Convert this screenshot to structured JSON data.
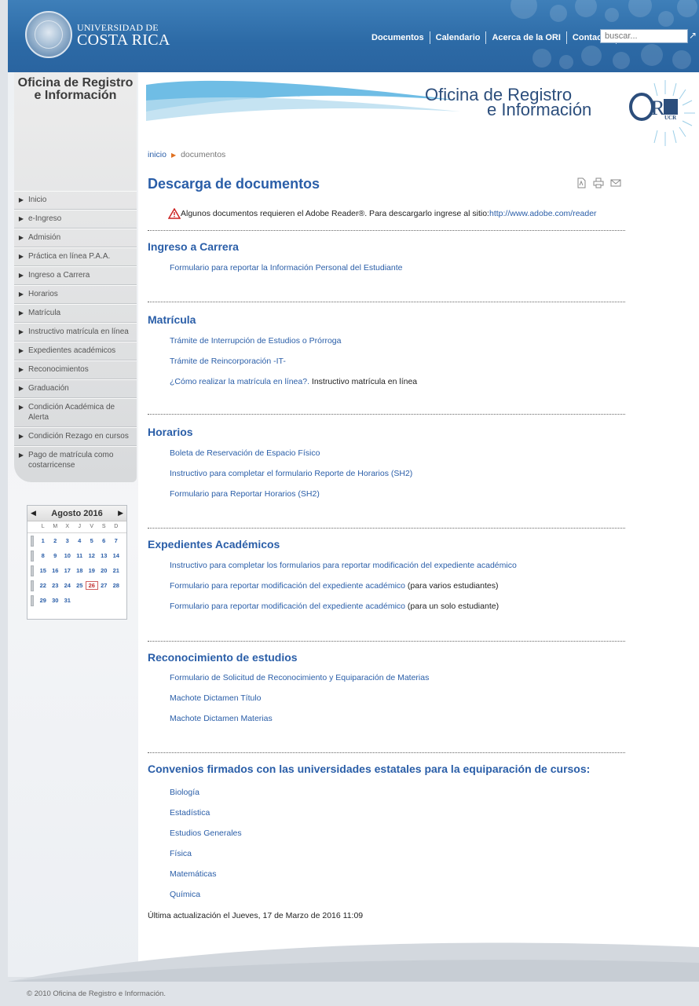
{
  "header": {
    "logo_line1": "UNIVERSIDAD DE",
    "logo_line2": "COSTA RICA",
    "nav": [
      "Documentos",
      "Calendario",
      "Acerca de la ORI",
      "Contacto"
    ],
    "search_placeholder": "buscar..."
  },
  "sidebar": {
    "title": "Oficina de Registro e Información",
    "items": [
      "Inicio",
      "e-Ingreso",
      "Admisión",
      "Práctica en línea P.A.A.",
      "Ingreso a Carrera",
      "Horarios",
      "Matrícula",
      "Instructivo matrícula en línea",
      "Expedientes académicos",
      "Reconocimientos",
      "Graduación",
      "Condición Académica de Alerta",
      "Condición Rezago en cursos",
      "Pago de matrícula como costarricense"
    ]
  },
  "calendar": {
    "month": "Agosto 2016",
    "days": [
      "L",
      "M",
      "X",
      "J",
      "V",
      "S",
      "D"
    ],
    "weeks": [
      [
        "1",
        "2",
        "3",
        "4",
        "5",
        "6",
        "7"
      ],
      [
        "8",
        "9",
        "10",
        "11",
        "12",
        "13",
        "14"
      ],
      [
        "15",
        "16",
        "17",
        "18",
        "19",
        "20",
        "21"
      ],
      [
        "22",
        "23",
        "24",
        "25",
        "26",
        "27",
        "28"
      ],
      [
        "29",
        "30",
        "31"
      ]
    ],
    "today": "26"
  },
  "banner": {
    "title_line1": "Oficina de Registro",
    "title_line2": "e Información",
    "logo_text": "ORI",
    "logo_sub": "UCR"
  },
  "breadcrumb": {
    "home": "inicio",
    "current": "documentos"
  },
  "page": {
    "title": "Descarga de documentos",
    "notice_text": "Algunos documentos requieren el Adobe Reader®. Para descargarlo ingrese al sitio: ",
    "notice_link": "http://www.adobe.com/reader",
    "updated": "Última actualización el Jueves, 17 de Marzo de 2016 11:09"
  },
  "sections": [
    {
      "title": "Ingreso a Carrera",
      "links": [
        {
          "text": "Formulario para reportar la Información Personal del Estudiante",
          "suffix": ""
        }
      ]
    },
    {
      "title": "Matrícula",
      "links": [
        {
          "text": "Trámite de Interrupción de Estudios o Prórroga",
          "suffix": ""
        },
        {
          "text": "Trámite de Reincorporación -IT-",
          "suffix": ""
        },
        {
          "text": "¿Cómo realizar la matrícula en línea?.",
          "suffix": " Instructivo matrícula en línea"
        }
      ]
    },
    {
      "title": "Horarios",
      "links": [
        {
          "text": "Boleta de Reservación de Espacio Físico",
          "suffix": ""
        },
        {
          "text": "Instructivo para completar el formulario Reporte de Horarios (SH2)",
          "suffix": ""
        },
        {
          "text": "Formulario para Reportar Horarios (SH2)",
          "suffix": ""
        }
      ]
    },
    {
      "title": "Expedientes Académicos",
      "links": [
        {
          "text": "Instructivo para completar los formularios para reportar modificación del expediente académico",
          "suffix": ""
        },
        {
          "text": "Formulario para reportar modificación del expediente académico",
          "suffix": " (para varios estudiantes)"
        },
        {
          "text": "Formulario para reportar modificación del expediente académico",
          "suffix": " (para un solo estudiante)"
        }
      ]
    },
    {
      "title": "Reconocimiento de estudios",
      "links": [
        {
          "text": "Formulario de Solicitud de Reconocimiento y Equiparación de Materias",
          "suffix": ""
        },
        {
          "text": "Machote Dictamen Título",
          "suffix": ""
        },
        {
          "text": "Machote Dictamen Materias",
          "suffix": ""
        }
      ]
    },
    {
      "title": "Convenios firmados con las universidades estatales para la equiparación de cursos:",
      "links": [
        {
          "text": "Biología",
          "suffix": ""
        },
        {
          "text": "Estadística",
          "suffix": ""
        },
        {
          "text": "Estudios Generales",
          "suffix": ""
        },
        {
          "text": "Física",
          "suffix": ""
        },
        {
          "text": "Matemáticas",
          "suffix": ""
        },
        {
          "text": "Química",
          "suffix": ""
        }
      ]
    }
  ],
  "footer": {
    "text": "© 2010 Oficina de Registro e Información."
  },
  "colors": {
    "header": "#2c6aa6",
    "link": "#2a5ea8",
    "title": "#2c4e7c"
  }
}
